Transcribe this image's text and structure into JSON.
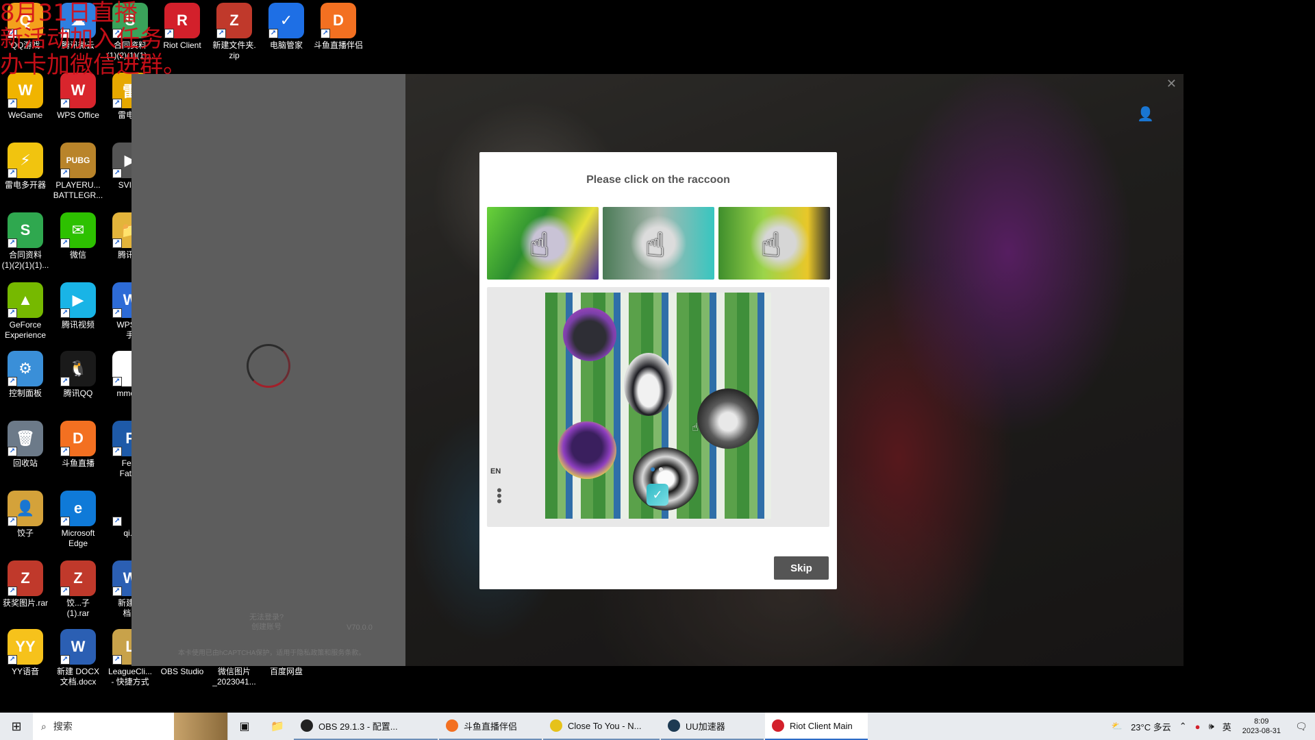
{
  "desktop": {
    "overlay_text": "8月31日直播\n新活动加入任务\n办卡加微信进群。",
    "icons": [
      {
        "label": "QQ游戏",
        "glyph": "Q",
        "color": "#f4a11c",
        "icon": "qq-game-icon"
      },
      {
        "label": "腾讯微云",
        "glyph": "☁",
        "color": "#2f7fe0",
        "icon": "weiyun-icon"
      },
      {
        "label": "合同资料\n(1)(2)(1)(1)...",
        "glyph": "S",
        "color": "#3aa35a",
        "icon": "spreadsheet-icon"
      },
      {
        "label": "Riot Client",
        "glyph": "R",
        "color": "#d3202b",
        "icon": "riot-client-icon"
      },
      {
        "label": "新建文件夹.\nzip",
        "glyph": "Z",
        "color": "#c0392b",
        "icon": "zip-archive-icon"
      },
      {
        "label": "电脑管家",
        "glyph": "✓",
        "color": "#1e6fe5",
        "icon": "pc-manager-icon"
      },
      {
        "label": "斗鱼直播伴侣",
        "glyph": "D",
        "color": "#f37021",
        "icon": "douyu-icon"
      },
      {
        "label": "WeGame",
        "glyph": "W",
        "color": "#f0b400",
        "icon": "wegame-icon"
      },
      {
        "label": "WPS Office",
        "glyph": "W",
        "color": "#d9252d",
        "icon": "wps-office-icon"
      },
      {
        "label": "雷电模",
        "glyph": "雷",
        "color": "#e6a800",
        "icon": "ldplayer-icon"
      },
      {
        "label": "雷电多开器",
        "glyph": "⚡",
        "color": "#f1c40f",
        "icon": "ld-multi-icon"
      },
      {
        "label": "PLAYERU...\nBATTLEGR...",
        "glyph": "PUBG",
        "color": "#b9842a",
        "icon": "pubg-icon"
      },
      {
        "label": "SVID_",
        "glyph": "▶",
        "color": "#555555",
        "icon": "video-file-icon"
      },
      {
        "label": "合同资料\n(1)(2)(1)(1)...",
        "glyph": "S",
        "color": "#2fa84f",
        "icon": "spreadsheet-icon"
      },
      {
        "label": "微信",
        "glyph": "✉",
        "color": "#2dc100",
        "icon": "wechat-icon"
      },
      {
        "label": "腾讯影",
        "glyph": "📁",
        "color": "#e3b43b",
        "icon": "folder-icon"
      },
      {
        "label": "GeForce\nExperience",
        "glyph": "▲",
        "color": "#76b900",
        "icon": "geforce-icon"
      },
      {
        "label": "腾讯视频",
        "glyph": "▶",
        "color": "#19b4e6",
        "icon": "tencent-video-icon"
      },
      {
        "label": "WPS办\n手",
        "glyph": "W",
        "color": "#2d6bd6",
        "icon": "wps-icon"
      },
      {
        "label": "控制面板",
        "glyph": "⚙",
        "color": "#3a8fd8",
        "icon": "control-panel-icon"
      },
      {
        "label": "腾讯QQ",
        "glyph": "🐧",
        "color": "#1a1a1a",
        "icon": "qq-icon"
      },
      {
        "label": "mmexp",
        "glyph": "",
        "color": "#ffffff",
        "icon": "file-icon"
      },
      {
        "label": "回收站",
        "glyph": "🗑",
        "color": "#6c7a89",
        "icon": "recycle-bin-icon"
      },
      {
        "label": "斗鱼直播",
        "glyph": "D",
        "color": "#f37021",
        "icon": "douyu-live-icon"
      },
      {
        "label": "Fear\nFatho",
        "glyph": "F",
        "color": "#1e5aa8",
        "icon": "fear-fathom-icon"
      },
      {
        "label": "饺子",
        "glyph": "👤",
        "color": "#d4a23a",
        "icon": "folder-user-icon"
      },
      {
        "label": "Microsoft\nEdge",
        "glyph": "e",
        "color": "#0f7ad8",
        "icon": "edge-icon"
      },
      {
        "label": "qi.p",
        "glyph": "",
        "color": "#000000",
        "icon": "file-icon"
      },
      {
        "label": "获奖图片.rar",
        "glyph": "Z",
        "color": "#c0392b",
        "icon": "rar-archive-icon"
      },
      {
        "label": "饺...子\n(1).rar",
        "glyph": "Z",
        "color": "#c0392b",
        "icon": "rar-archive-icon"
      },
      {
        "label": "新建 D\n档.c",
        "glyph": "W",
        "color": "#2b5fb3",
        "icon": "word-doc-icon"
      },
      {
        "label": "YY语音",
        "glyph": "YY",
        "color": "#f6c21b",
        "icon": "yy-icon"
      },
      {
        "label": "新建 DOCX\n文档.docx",
        "glyph": "W",
        "color": "#2b5fb3",
        "icon": "word-doc-icon"
      },
      {
        "label": "LeagueCli...\n- 快捷方式",
        "glyph": "L",
        "color": "#c8a24a",
        "icon": "league-client-icon"
      },
      {
        "label": "OBS Studio",
        "glyph": "",
        "color": "#000000",
        "icon": "obs-icon"
      },
      {
        "label": "微信图片\n_2023041...",
        "glyph": "",
        "color": "#000000",
        "icon": "image-file-icon"
      },
      {
        "label": "百度网盘",
        "glyph": "",
        "color": "#000000",
        "icon": "baidu-netdisk-icon"
      }
    ]
  },
  "riot_left": {
    "login_help": "无法登录?\n创建账号",
    "version": "V70.0.0",
    "footer": "本卡使用已由hCAPTCHA保护，适用于隐私政策和服务条款。"
  },
  "captcha": {
    "title": "Please click on the raccoon",
    "language": "EN",
    "skip_label": "Skip",
    "page_count": 2,
    "current_page": 1
  },
  "taskbar": {
    "search_placeholder": "搜索",
    "apps": [
      {
        "label": "OBS 29.1.3 - 配置...",
        "color": "#222222",
        "active": false
      },
      {
        "label": "斗鱼直播伴侣",
        "color": "#f37021",
        "active": false
      },
      {
        "label": "Close To You - N...",
        "color": "#e6c21a",
        "active": false
      },
      {
        "label": "UU加速器",
        "color": "#1d3a52",
        "active": false
      },
      {
        "label": "Riot Client Main",
        "color": "#d3202b",
        "active": true
      }
    ],
    "weather": "23°C 多云",
    "ime": "英",
    "time": "8:09",
    "date": "2023-08-31"
  }
}
